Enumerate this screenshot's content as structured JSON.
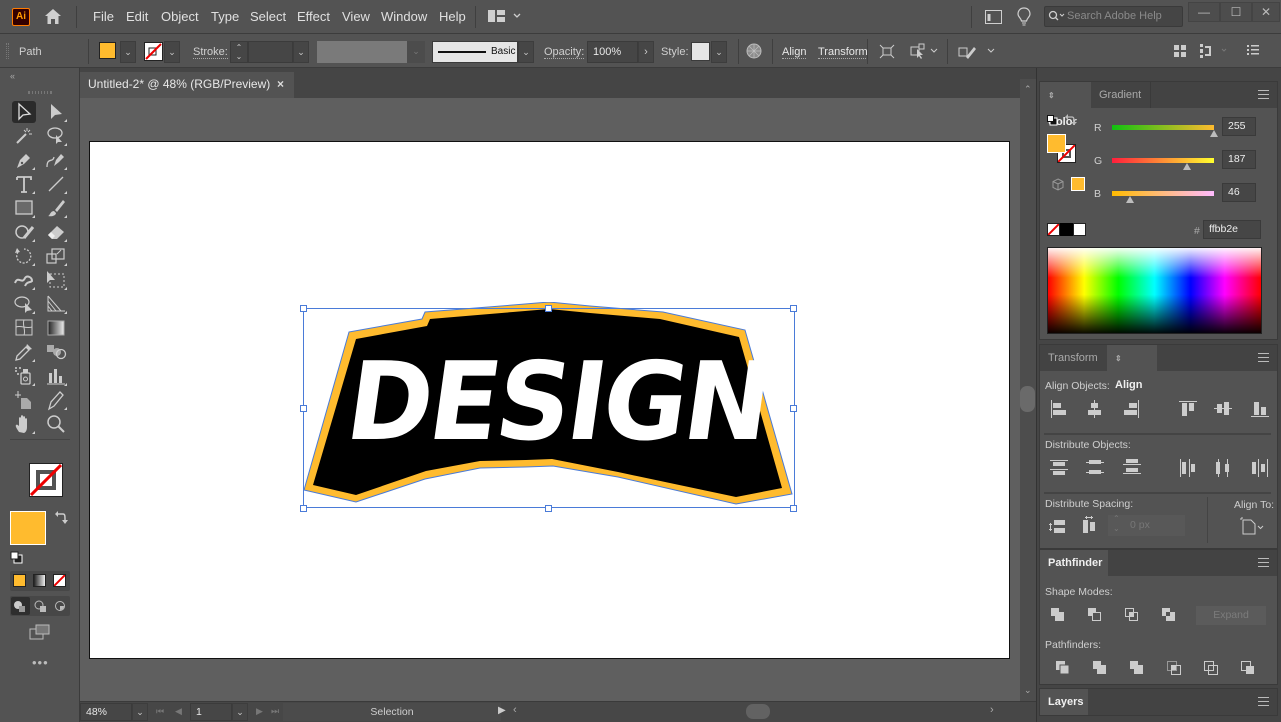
{
  "app": {
    "logo": "Ai",
    "name": "Adobe Illustrator"
  },
  "menubar": {
    "items": [
      "File",
      "Edit",
      "Object",
      "Type",
      "Select",
      "Effect",
      "View",
      "Window",
      "Help"
    ],
    "search_placeholder": "Search Adobe Help",
    "window_controls": {
      "minimize": "—",
      "maximize": "☐",
      "close": "✕"
    }
  },
  "controlbar": {
    "selection_type": "Path",
    "fill_color": "#ffbb2e",
    "stroke_label": "Stroke:",
    "stroke_value": "",
    "brush_profile": "Basic",
    "opacity_label": "Opacity:",
    "opacity_value": "100%",
    "style_label": "Style:",
    "align_link": "Align",
    "transform_link": "Transform"
  },
  "document": {
    "tab_title": "Untitled-2* @ 48% (RGB/Preview)",
    "artwork_text": "DESIGN",
    "artwork_colors": {
      "fill": "#000000",
      "outline": "#ffbb2e",
      "text": "#ffffff",
      "selection": "#4a7bd8"
    }
  },
  "statusbar": {
    "zoom": "48%",
    "artboard": "1",
    "tool": "Selection"
  },
  "tools": {
    "fill_color": "#ffbb2e"
  },
  "color_panel": {
    "tabs": [
      "Color",
      "Gradient"
    ],
    "active_tab": "Color",
    "channels": [
      {
        "label": "R",
        "value": "255",
        "fraction": 1.0
      },
      {
        "label": "G",
        "value": "187",
        "fraction": 0.733
      },
      {
        "label": "B",
        "value": "46",
        "fraction": 0.18
      }
    ],
    "hex_label": "#",
    "hex_value": "ffbb2e"
  },
  "align_panel": {
    "tabs": [
      "Transform",
      "Align"
    ],
    "active_tab": "Align",
    "align_objects_label": "Align Objects:",
    "distribute_objects_label": "Distribute Objects:",
    "distribute_spacing_label": "Distribute Spacing:",
    "align_to_label": "Align To:",
    "spacing_value": "0 px"
  },
  "pathfinder_panel": {
    "title": "Pathfinder",
    "shape_modes_label": "Shape Modes:",
    "expand_label": "Expand",
    "pathfinders_label": "Pathfinders:"
  },
  "layers_panel": {
    "title": "Layers"
  }
}
